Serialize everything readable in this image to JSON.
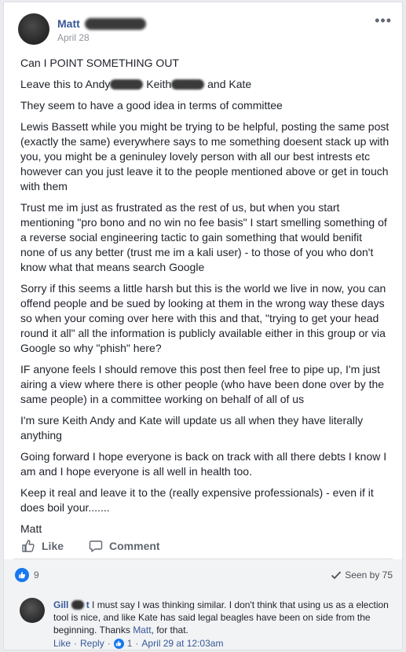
{
  "post": {
    "author": "Matt",
    "date": "April 28",
    "more_icon": "more-horizontal-icon",
    "body": {
      "p1": "Can I POINT SOMETHING OUT",
      "p2_a": "Leave this to Andy",
      "p2_b": " Keith",
      "p2_c": " and Kate",
      "p3": "They seem to have a good idea in terms of committee",
      "p4": "Lewis Bassett while you might be trying to be helpful, posting the same post (exactly the same) everywhere says to me something doesent stack up with you, you might be a geninuley lovely person with all our best intrests etc however can you just leave it to the people mentioned above or get in touch with them",
      "p5": "Trust me im just as frustrated as the rest of us, but when you start mentioning \"pro bono and no win no fee basis\" I start smelling something of a reverse social engineering tactic to gain something that would benifit none of us any better (trust me im a kali user) - to those of you who don't know what that means search Google",
      "p6": "Sorry if this seems a little harsh but this is the world we live in now, you can offend people and be sued by looking at them in the wrong way these days so when your coming over here with this and that, \"trying to get your head round it all\" all the information is publicly available either in this group or via Google so why \"phish\" here?",
      "p7": "IF anyone feels I should remove this post then feel free to pipe up, I'm just airing a view where there is other people (who have been done over by the same people) in a committee working on behalf of all of us",
      "p8": "I'm sure Keith Andy and Kate will update us all when they have literally anything",
      "p9": "Going forward I hope everyone is back on track with all there debts I know I am and I hope everyone is all well in health too.",
      "p10": "Keep it real and leave it to the (really expensive professionals) - even if it does boil your.......",
      "p11": "Matt"
    }
  },
  "actions": {
    "like_label": "Like",
    "comment_label": "Comment"
  },
  "stats": {
    "like_count": "9",
    "seen_by": "Seen by 75"
  },
  "comment": {
    "author": "Gill",
    "author_suffix": "t",
    "text_a": " I must say I was thinking similar. I don't think that using us as a election tool is nice, and like Kate has said legal beagles have been on side from the beginning. Thanks ",
    "mention": "Matt",
    "text_b": ", for that.",
    "like_link": "Like",
    "reply_link": "Reply",
    "reaction_count": "1",
    "time": "April 29 at 12:03am"
  },
  "colors": {
    "link_blue": "#365899",
    "like_blue": "#1877f2",
    "meta_gray": "#606770",
    "background": "#e9ebee"
  }
}
